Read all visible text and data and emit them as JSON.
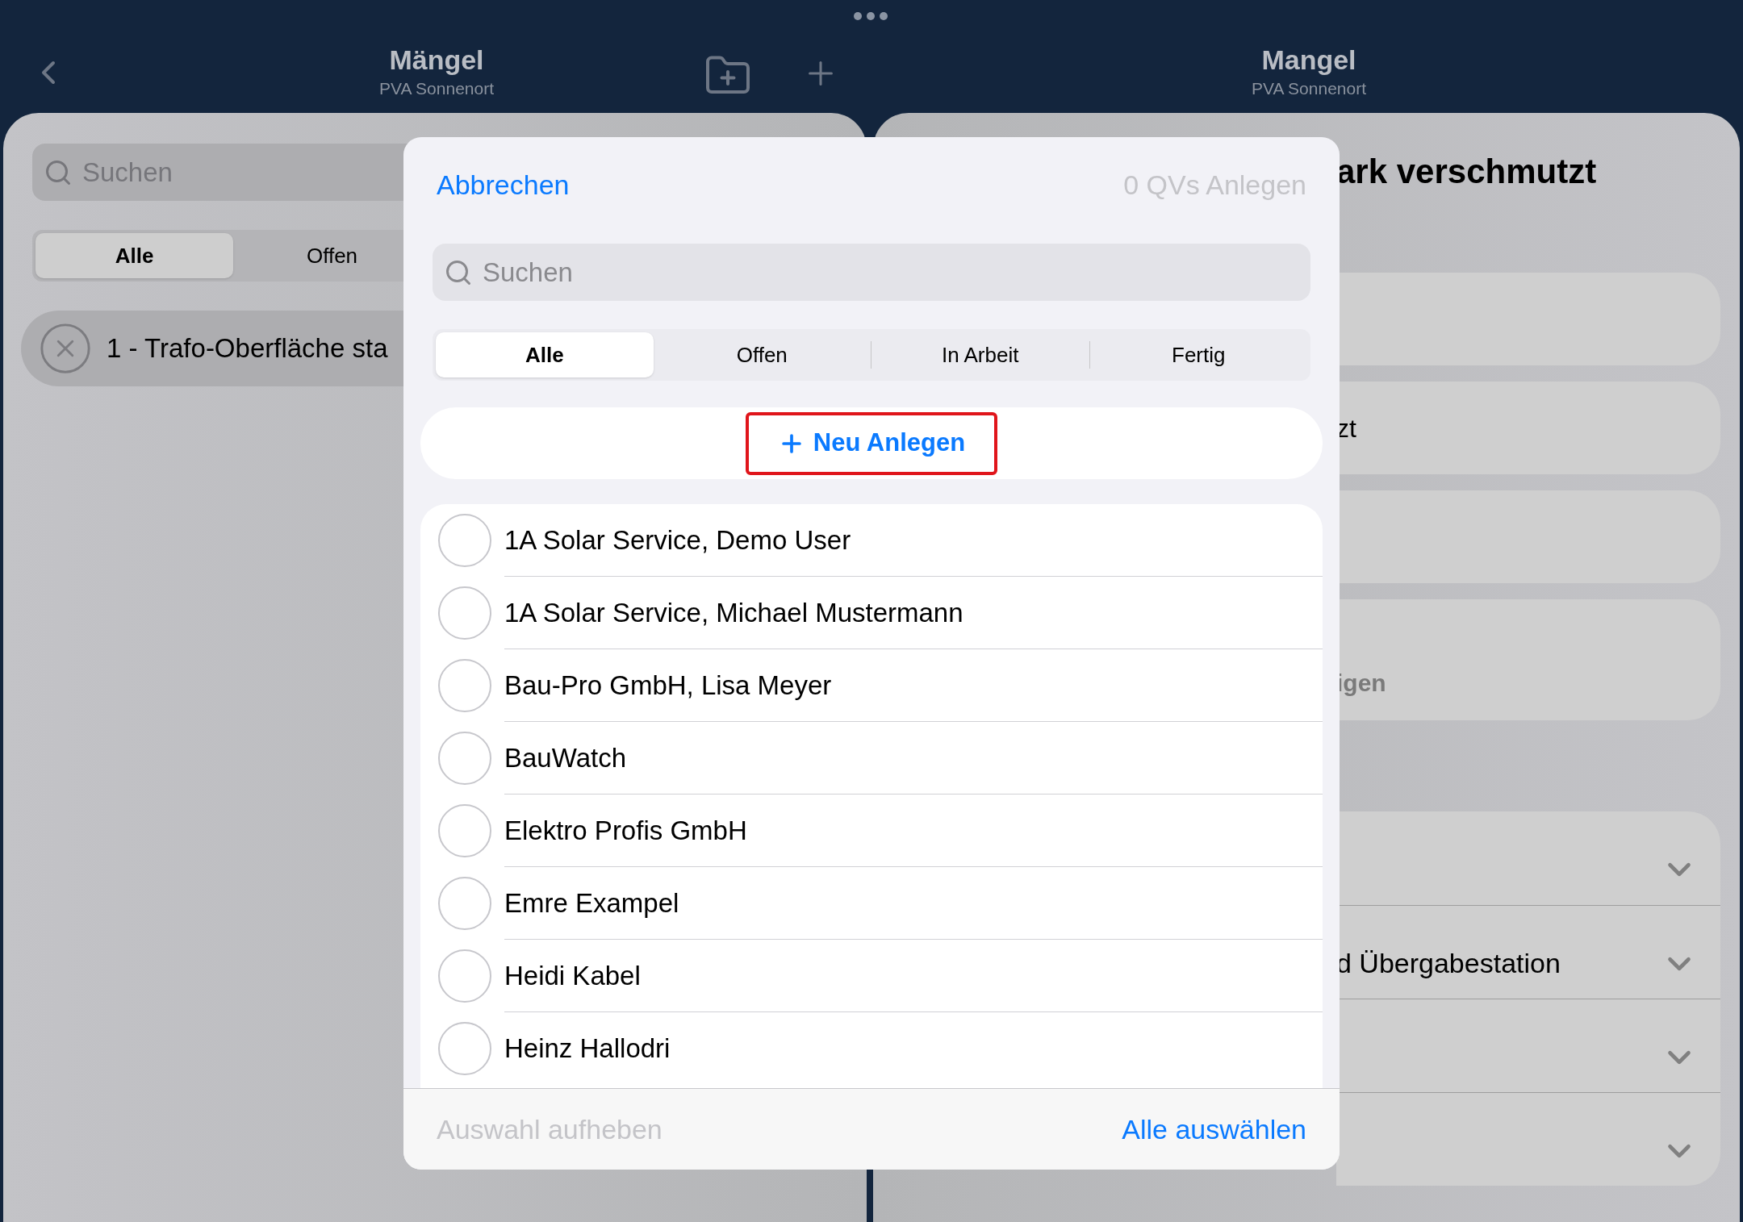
{
  "top_bar": {
    "left_title": "Mängel",
    "left_subtitle": "PVA Sonnenort",
    "right_title": "Mangel",
    "right_subtitle": "PVA Sonnenort"
  },
  "left_panel": {
    "search": {
      "placeholder": "Suchen"
    },
    "filters": [
      {
        "label": "Alle",
        "selected": true
      },
      {
        "label": "Offen",
        "selected": false
      }
    ],
    "items": [
      {
        "title": "1 - Trafo-Oberfläche sta"
      }
    ]
  },
  "right_panel": {
    "title": "ark verschmutzt",
    "fields": [
      {
        "kind": "empty"
      },
      {
        "kind": "value",
        "text": "zt"
      },
      {
        "kind": "empty"
      },
      {
        "kind": "hint",
        "text": "igen"
      }
    ],
    "sections": [
      {
        "expanded": false
      },
      {
        "text": "d Übergabestation",
        "expanded": false
      },
      {
        "expanded": false
      },
      {
        "expanded": false
      }
    ]
  },
  "dialog": {
    "cancel": "Abbrechen",
    "confirm": {
      "label": "0 QVs Anlegen",
      "disabled": true
    },
    "search": {
      "placeholder": "Suchen"
    },
    "filters": [
      {
        "label": "Alle",
        "selected": true
      },
      {
        "label": "Offen",
        "selected": false
      },
      {
        "label": "In Arbeit",
        "selected": false
      },
      {
        "label": "Fertig",
        "selected": false
      }
    ],
    "new_button": {
      "label": "Neu Anlegen",
      "highlighted": true
    },
    "contacts": [
      {
        "name": "1A Solar Service, Demo User",
        "selected": false
      },
      {
        "name": "1A Solar Service, Michael Mustermann",
        "selected": false
      },
      {
        "name": "Bau-Pro GmbH, Lisa Meyer",
        "selected": false
      },
      {
        "name": "BauWatch",
        "selected": false
      },
      {
        "name": "Elektro Profis GmbH",
        "selected": false
      },
      {
        "name": "Emre Exampel",
        "selected": false
      },
      {
        "name": "Heidi Kabel",
        "selected": false
      },
      {
        "name": "Heinz Hallodri",
        "selected": false
      }
    ],
    "footer": {
      "deselect": {
        "label": "Auswahl aufheben",
        "disabled": true
      },
      "select_all": {
        "label": "Alle auswählen",
        "disabled": false
      }
    }
  }
}
